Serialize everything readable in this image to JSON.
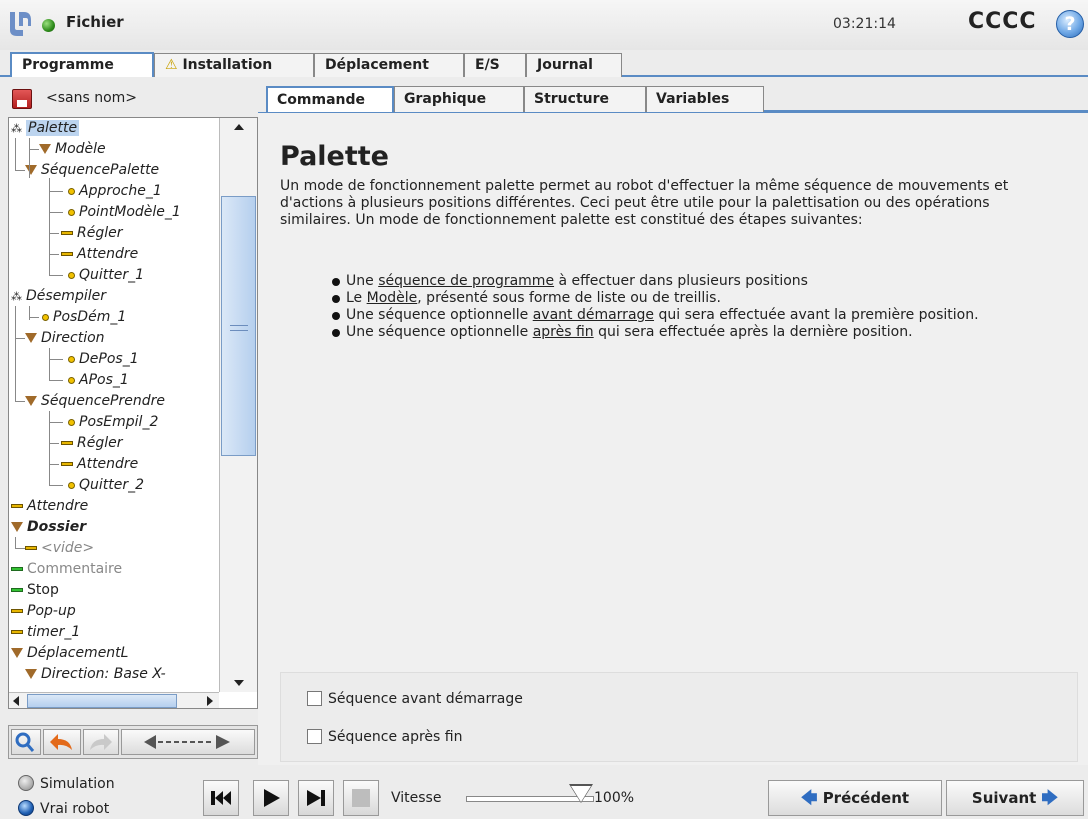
{
  "header": {
    "title": "Fichier",
    "clock": "03:21:14",
    "robot_name": "CCCC",
    "help_glyph": "?"
  },
  "main_tabs": [
    {
      "label": "Programme",
      "active": true
    },
    {
      "label": "Installation",
      "warning": true
    },
    {
      "label": "Déplacement"
    },
    {
      "label": "E/S"
    },
    {
      "label": "Journal"
    }
  ],
  "left": {
    "program_name": "<sans nom>",
    "tree": [
      {
        "label": "Palette",
        "icon": "palette-icon",
        "selected": true
      },
      {
        "label": "Modèle",
        "icon": "folder-triangle-icon"
      },
      {
        "label": "SéquencePalette",
        "icon": "folder-triangle-icon"
      },
      {
        "label": "Approche_1",
        "icon": "waypoint-dot-icon"
      },
      {
        "label": "PointModèle_1",
        "icon": "waypoint-dot-icon"
      },
      {
        "label": "Régler",
        "icon": "command-dash-icon"
      },
      {
        "label": "Attendre",
        "icon": "command-dash-icon"
      },
      {
        "label": "Quitter_1",
        "icon": "waypoint-dot-icon"
      },
      {
        "label": "Désempiler",
        "icon": "palette-icon"
      },
      {
        "label": "PosDém_1",
        "icon": "waypoint-dot-icon"
      },
      {
        "label": "Direction",
        "icon": "folder-triangle-icon"
      },
      {
        "label": "DePos_1",
        "icon": "waypoint-dot-icon"
      },
      {
        "label": "APos_1",
        "icon": "waypoint-dot-icon"
      },
      {
        "label": "SéquencePrendre",
        "icon": "folder-triangle-icon"
      },
      {
        "label": "PosEmpil_2",
        "icon": "waypoint-dot-icon"
      },
      {
        "label": "Régler",
        "icon": "command-dash-icon"
      },
      {
        "label": "Attendre",
        "icon": "command-dash-icon"
      },
      {
        "label": "Quitter_2",
        "icon": "waypoint-dot-icon"
      },
      {
        "label": "Attendre",
        "icon": "command-dash-icon"
      },
      {
        "label": "Dossier",
        "icon": "folder-triangle-icon"
      },
      {
        "label": "<vide>",
        "icon": "command-dash-icon"
      },
      {
        "label": "Commentaire",
        "icon": "comment-dash-icon"
      },
      {
        "label": "Stop",
        "icon": "stop-dash-icon"
      },
      {
        "label": "Pop-up",
        "icon": "command-dash-icon"
      },
      {
        "label": "timer_1",
        "icon": "command-dash-icon"
      },
      {
        "label": "DéplacementL",
        "icon": "folder-triangle-icon"
      },
      {
        "label": "Direction: Base X-",
        "icon": "folder-triangle-icon"
      }
    ]
  },
  "sub_tabs": [
    {
      "label": "Commande",
      "active": true
    },
    {
      "label": "Graphique"
    },
    {
      "label": "Structure"
    },
    {
      "label": "Variables"
    }
  ],
  "content": {
    "title": "Palette",
    "intro": "Un mode de fonctionnement palette permet au robot d'effectuer la même séquence de mouvements et d'actions à plusieurs positions différentes. Ceci peut être utile pour la palettisation ou des opérations similaires. Un mode de fonctionnement palette est constitué des étapes suivantes:",
    "bullets": [
      {
        "before": "Une ",
        "link": "séquence de programme",
        "after": " à effectuer dans plusieurs positions"
      },
      {
        "before": "Le ",
        "link": "Modèle",
        "after": ", présenté sous forme de liste ou de treillis."
      },
      {
        "before": "Une séquence optionnelle ",
        "link": "avant démarrage",
        "after": " qui sera effectuée avant la première position."
      },
      {
        "before": "Une séquence optionnelle ",
        "link": "après fin",
        "after": " qui sera effectuée après la dernière position."
      }
    ],
    "options": {
      "before_start": "Séquence avant démarrage",
      "after_end": "Séquence après fin"
    }
  },
  "bottom": {
    "simulation": "Simulation",
    "real_robot": "Vrai robot",
    "speed_label": "Vitesse",
    "speed_value": "100%",
    "speed_fraction": 1.0,
    "prev": "Précédent",
    "next": "Suivant",
    "prev_arrow": "🡄",
    "next_arrow": "🡆"
  },
  "colors": {
    "accent": "#5a8bc4",
    "selection": "#bcd4ef",
    "command_icon": "#e7b600",
    "comment_icon": "#33c233",
    "folder_icon": "#a06a2a"
  }
}
